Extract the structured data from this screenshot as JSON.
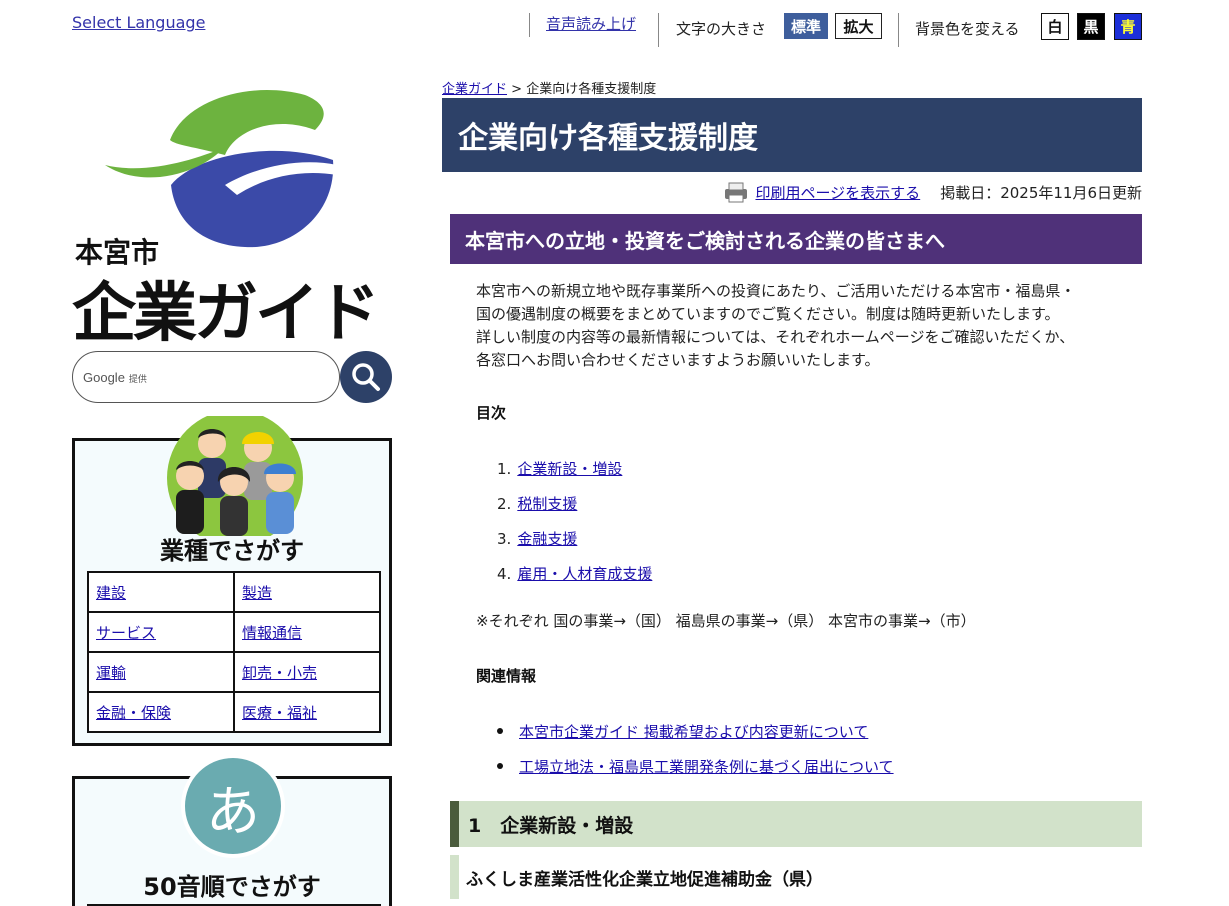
{
  "top_bar": {
    "language_link": "Select Language",
    "voice_link": "音声読み上げ",
    "text_size_label": "文字の大きさ",
    "text_size_normal": "標準",
    "text_size_large": "拡大",
    "bg_label": "背景色を変える",
    "bg_white": "白",
    "bg_black": "黒",
    "bg_blue": "青"
  },
  "logo": {
    "city": "本宮市",
    "guide": "企業ガイド",
    "colors": {
      "green": "#6db33f",
      "blue": "#3b4aa8"
    }
  },
  "search": {
    "placeholder": "Google",
    "provider": "提供"
  },
  "industry_panel": {
    "title": "業種でさがす",
    "categories": [
      [
        "建設",
        "製造"
      ],
      [
        "サービス",
        "情報通信"
      ],
      [
        "運輸",
        "卸売・小売"
      ],
      [
        "金融・保険",
        "医療・福祉"
      ]
    ]
  },
  "kana_panel": {
    "glyph": "あ",
    "title": "50音順でさがす"
  },
  "breadcrumb": {
    "home": "企業ガイド",
    "separator": ">",
    "current": "企業向け各種支援制度"
  },
  "page": {
    "title": "企業向け各種支援制度",
    "print_link": "印刷用ページを表示する",
    "date": "掲載日：2025年11月6日更新"
  },
  "section": {
    "heading": "本宮市への立地・投資をご検討される企業の皆さまへ",
    "intro": [
      "本宮市への新規立地や既存事業所への投資にあたり、ご活用いただける本宮市・福島県・",
      "国の優遇制度の概要をまとめていますのでご覧ください。制度は随時更新いたします。",
      "詳しい制度の内容等の最新情報については、それぞれホームページをご確認いただくか、",
      "各窓口へお問い合わせくださいますようお願いいたします。"
    ],
    "toc_title": "目次",
    "toc": [
      "企業新設・増設",
      "税制支援",
      "金融支援",
      "雇用・人材育成支援"
    ],
    "note": "※それぞれ 国の事業→（国） 福島県の事業→（県） 本宮市の事業→（市）",
    "related_title": "関連情報",
    "related": [
      "本宮市企業ガイド 掲載希望および内容更新について",
      "工場立地法・福島県工業開発条例に基づく届出について"
    ]
  },
  "subsection": {
    "heading": "1　企業新設・増設",
    "subheading": "ふくしま産業活性化企業立地促進補助金（県）"
  }
}
